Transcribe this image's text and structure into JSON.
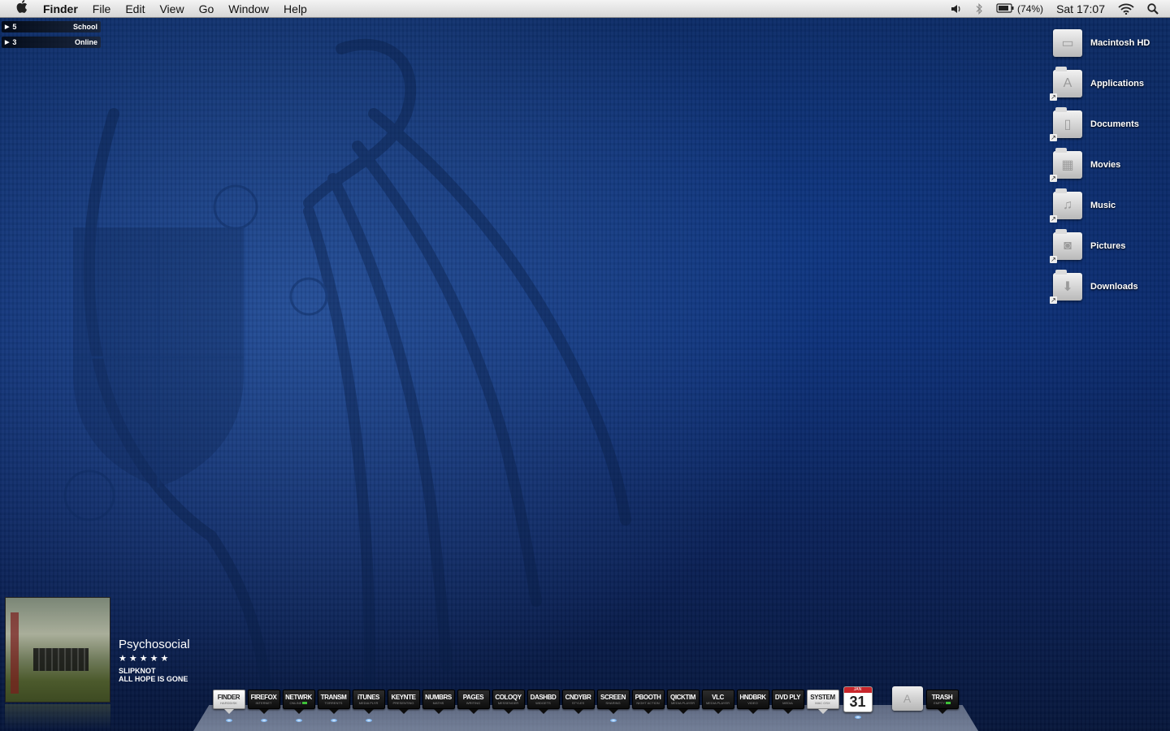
{
  "menubar": {
    "apple_icon": "apple-icon",
    "app_name": "Finder",
    "menus": [
      "File",
      "Edit",
      "View",
      "Go",
      "Window",
      "Help"
    ],
    "status": {
      "volume_icon": "volume-icon",
      "bluetooth_icon": "bluetooth-icon",
      "battery_icon": "battery-icon",
      "battery_percent": "(74%)",
      "clock": "Sat 17:07",
      "wifi_icon": "wifi-icon",
      "spotlight_icon": "search-icon"
    }
  },
  "widgets": [
    {
      "count": "5",
      "label": "School"
    },
    {
      "count": "3",
      "label": "Online"
    }
  ],
  "desktop_icons": [
    {
      "name": "Macintosh HD",
      "icon": "hard-drive-icon"
    },
    {
      "name": "Applications",
      "icon": "applications-folder-icon"
    },
    {
      "name": "Documents",
      "icon": "documents-folder-icon"
    },
    {
      "name": "Movies",
      "icon": "movies-folder-icon"
    },
    {
      "name": "Music",
      "icon": "music-folder-icon"
    },
    {
      "name": "Pictures",
      "icon": "pictures-folder-icon"
    },
    {
      "name": "Downloads",
      "icon": "downloads-folder-icon"
    }
  ],
  "now_playing": {
    "title": "Psychosocial",
    "rating": "★★★★★",
    "artist": "SLIPKNOT",
    "album": "ALL HOPE IS GONE"
  },
  "dock": {
    "items": [
      {
        "label": "FINDER",
        "sub": "HARDDISK",
        "light": true,
        "running": true
      },
      {
        "label": "FIREFOX",
        "sub": "INTERNET",
        "running": true
      },
      {
        "label": "NETWRK",
        "sub": "ONLINE",
        "led": true,
        "running": true
      },
      {
        "label": "TRANSM",
        "sub": "TORRENTS",
        "running": true
      },
      {
        "label": "iTUNES",
        "sub": "MEDIA PLYR",
        "running": true
      },
      {
        "label": "KEYNTE",
        "sub": "PRESENTING",
        "running": false
      },
      {
        "label": "NUMBRS",
        "sub": "MATHS",
        "running": false
      },
      {
        "label": "PAGES",
        "sub": "WRITING",
        "running": false
      },
      {
        "label": "COLOQY",
        "sub": "MESSENGER",
        "running": false
      },
      {
        "label": "DASHBD",
        "sub": "WIDGETS",
        "running": false
      },
      {
        "label": "CNDYBR",
        "sub": "STYLES",
        "running": false
      },
      {
        "label": "SCREEN",
        "sub": "SHARING",
        "running": true
      },
      {
        "label": "PBOOTH",
        "sub": "NIGHT ACTION",
        "running": false
      },
      {
        "label": "QICKTIM",
        "sub": "MEDIA PLAYER",
        "running": false
      },
      {
        "label": "VLC",
        "sub": "MEDIA PLAYER",
        "running": false
      },
      {
        "label": "HNDBRK",
        "sub": "VIDEO",
        "running": false
      },
      {
        "label": "DVD PLY",
        "sub": "MEDIA",
        "running": false
      },
      {
        "label": "SYSTEM",
        "sub": "MAC OSX",
        "light": true,
        "running": false
      }
    ],
    "calendar": {
      "month": "JAN",
      "day": "31",
      "icon": "calendar-icon",
      "running": true
    },
    "applications_stack_icon": "applications-stack-icon",
    "trash": {
      "label": "TRASH",
      "sub": "EMPTY",
      "led": true
    }
  }
}
